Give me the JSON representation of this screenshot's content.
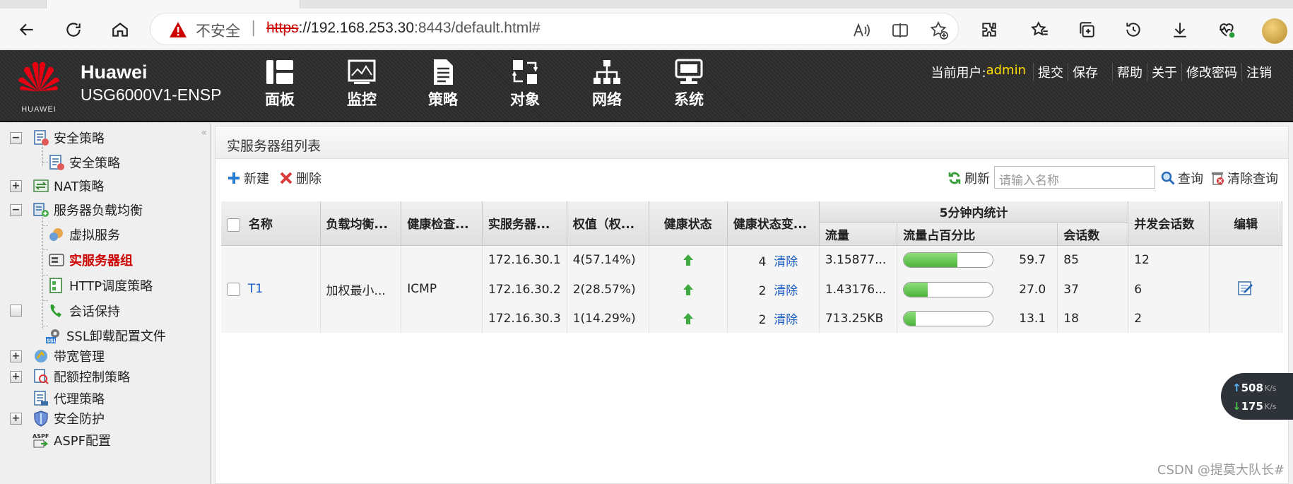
{
  "browser": {
    "security_label": "不安全",
    "url_scheme": "https",
    "url_host": "://192.168.253.30",
    "url_port": ":8443",
    "url_path": "/default.html#"
  },
  "header": {
    "brand_name": "Huawei",
    "device_model": "USG6000V1-ENSP",
    "logo_text": "HUAWEI",
    "nav": [
      {
        "label": "面板",
        "icon": "dashboard-icon"
      },
      {
        "label": "监控",
        "icon": "monitor-icon"
      },
      {
        "label": "策略",
        "icon": "policy-icon"
      },
      {
        "label": "对象",
        "icon": "object-icon"
      },
      {
        "label": "网络",
        "icon": "network-icon"
      },
      {
        "label": "系统",
        "icon": "system-icon"
      }
    ],
    "user_label": "当前用户:",
    "username": "admin",
    "actions": [
      "提交",
      "保存",
      "帮助",
      "关于",
      "修改密码",
      "注销"
    ]
  },
  "sidebar": {
    "items": [
      {
        "label": "安全策略",
        "toggle": "−"
      },
      {
        "label": "安全策略"
      },
      {
        "label": "NAT策略",
        "toggle": "+"
      },
      {
        "label": "服务器负载均衡",
        "toggle": "−"
      },
      {
        "label": "虚拟服务"
      },
      {
        "label": "实服务器组",
        "active": true
      },
      {
        "label": "HTTP调度策略"
      },
      {
        "label": "会话保持"
      },
      {
        "label": "SSL卸载配置文件"
      },
      {
        "label": "带宽管理",
        "toggle": "+"
      },
      {
        "label": "配额控制策略",
        "toggle": "+"
      },
      {
        "label": "代理策略"
      },
      {
        "label": "安全防护",
        "toggle": "+"
      },
      {
        "label": "ASPF配置"
      }
    ]
  },
  "main": {
    "panel_title": "实服务器组列表",
    "toolbar": {
      "new_label": "新建",
      "delete_label": "删除",
      "refresh_label": "刷新",
      "search_placeholder": "请输入名称",
      "query_label": "查询",
      "clear_query_label": "清除查询"
    },
    "table": {
      "headers": {
        "name": "名称",
        "lb": "负载均衡...",
        "hc": "健康检查...",
        "rs": "实服务器...",
        "weight": "权值（权...",
        "health": "健康状态",
        "health_change": "健康状态变...",
        "stats_group": "5分钟内统计",
        "traffic": "流量",
        "traffic_pct": "流量占百分比",
        "sessions": "会话数",
        "concurrent": "并发会话数",
        "edit": "编辑"
      },
      "group": {
        "name": "T1",
        "lb_algorithm": "加权最小...",
        "health_check": "ICMP"
      },
      "rows": [
        {
          "server": "172.16.30.1",
          "weight": "4(57.14%)",
          "health_changes": "4",
          "clear_label": "清除",
          "traffic": "3.15877...",
          "traffic_pct": 59.7,
          "traffic_pct_text": "59.7",
          "sessions": "85",
          "concurrent": "12"
        },
        {
          "server": "172.16.30.2",
          "weight": "2(28.57%)",
          "health_changes": "2",
          "clear_label": "清除",
          "traffic": "1.43176...",
          "traffic_pct": 27.0,
          "traffic_pct_text": "27.0",
          "sessions": "37",
          "concurrent": "6"
        },
        {
          "server": "172.16.30.3",
          "weight": "1(14.29%)",
          "health_changes": "2",
          "clear_label": "清除",
          "traffic": "713.25KB",
          "traffic_pct": 13.1,
          "traffic_pct_text": "13.1",
          "sessions": "18",
          "concurrent": "2"
        }
      ]
    }
  },
  "speed_widget": {
    "up": "508",
    "down": "175",
    "unit": "K/s"
  },
  "watermark": "CSDN @提莫大队长#"
}
